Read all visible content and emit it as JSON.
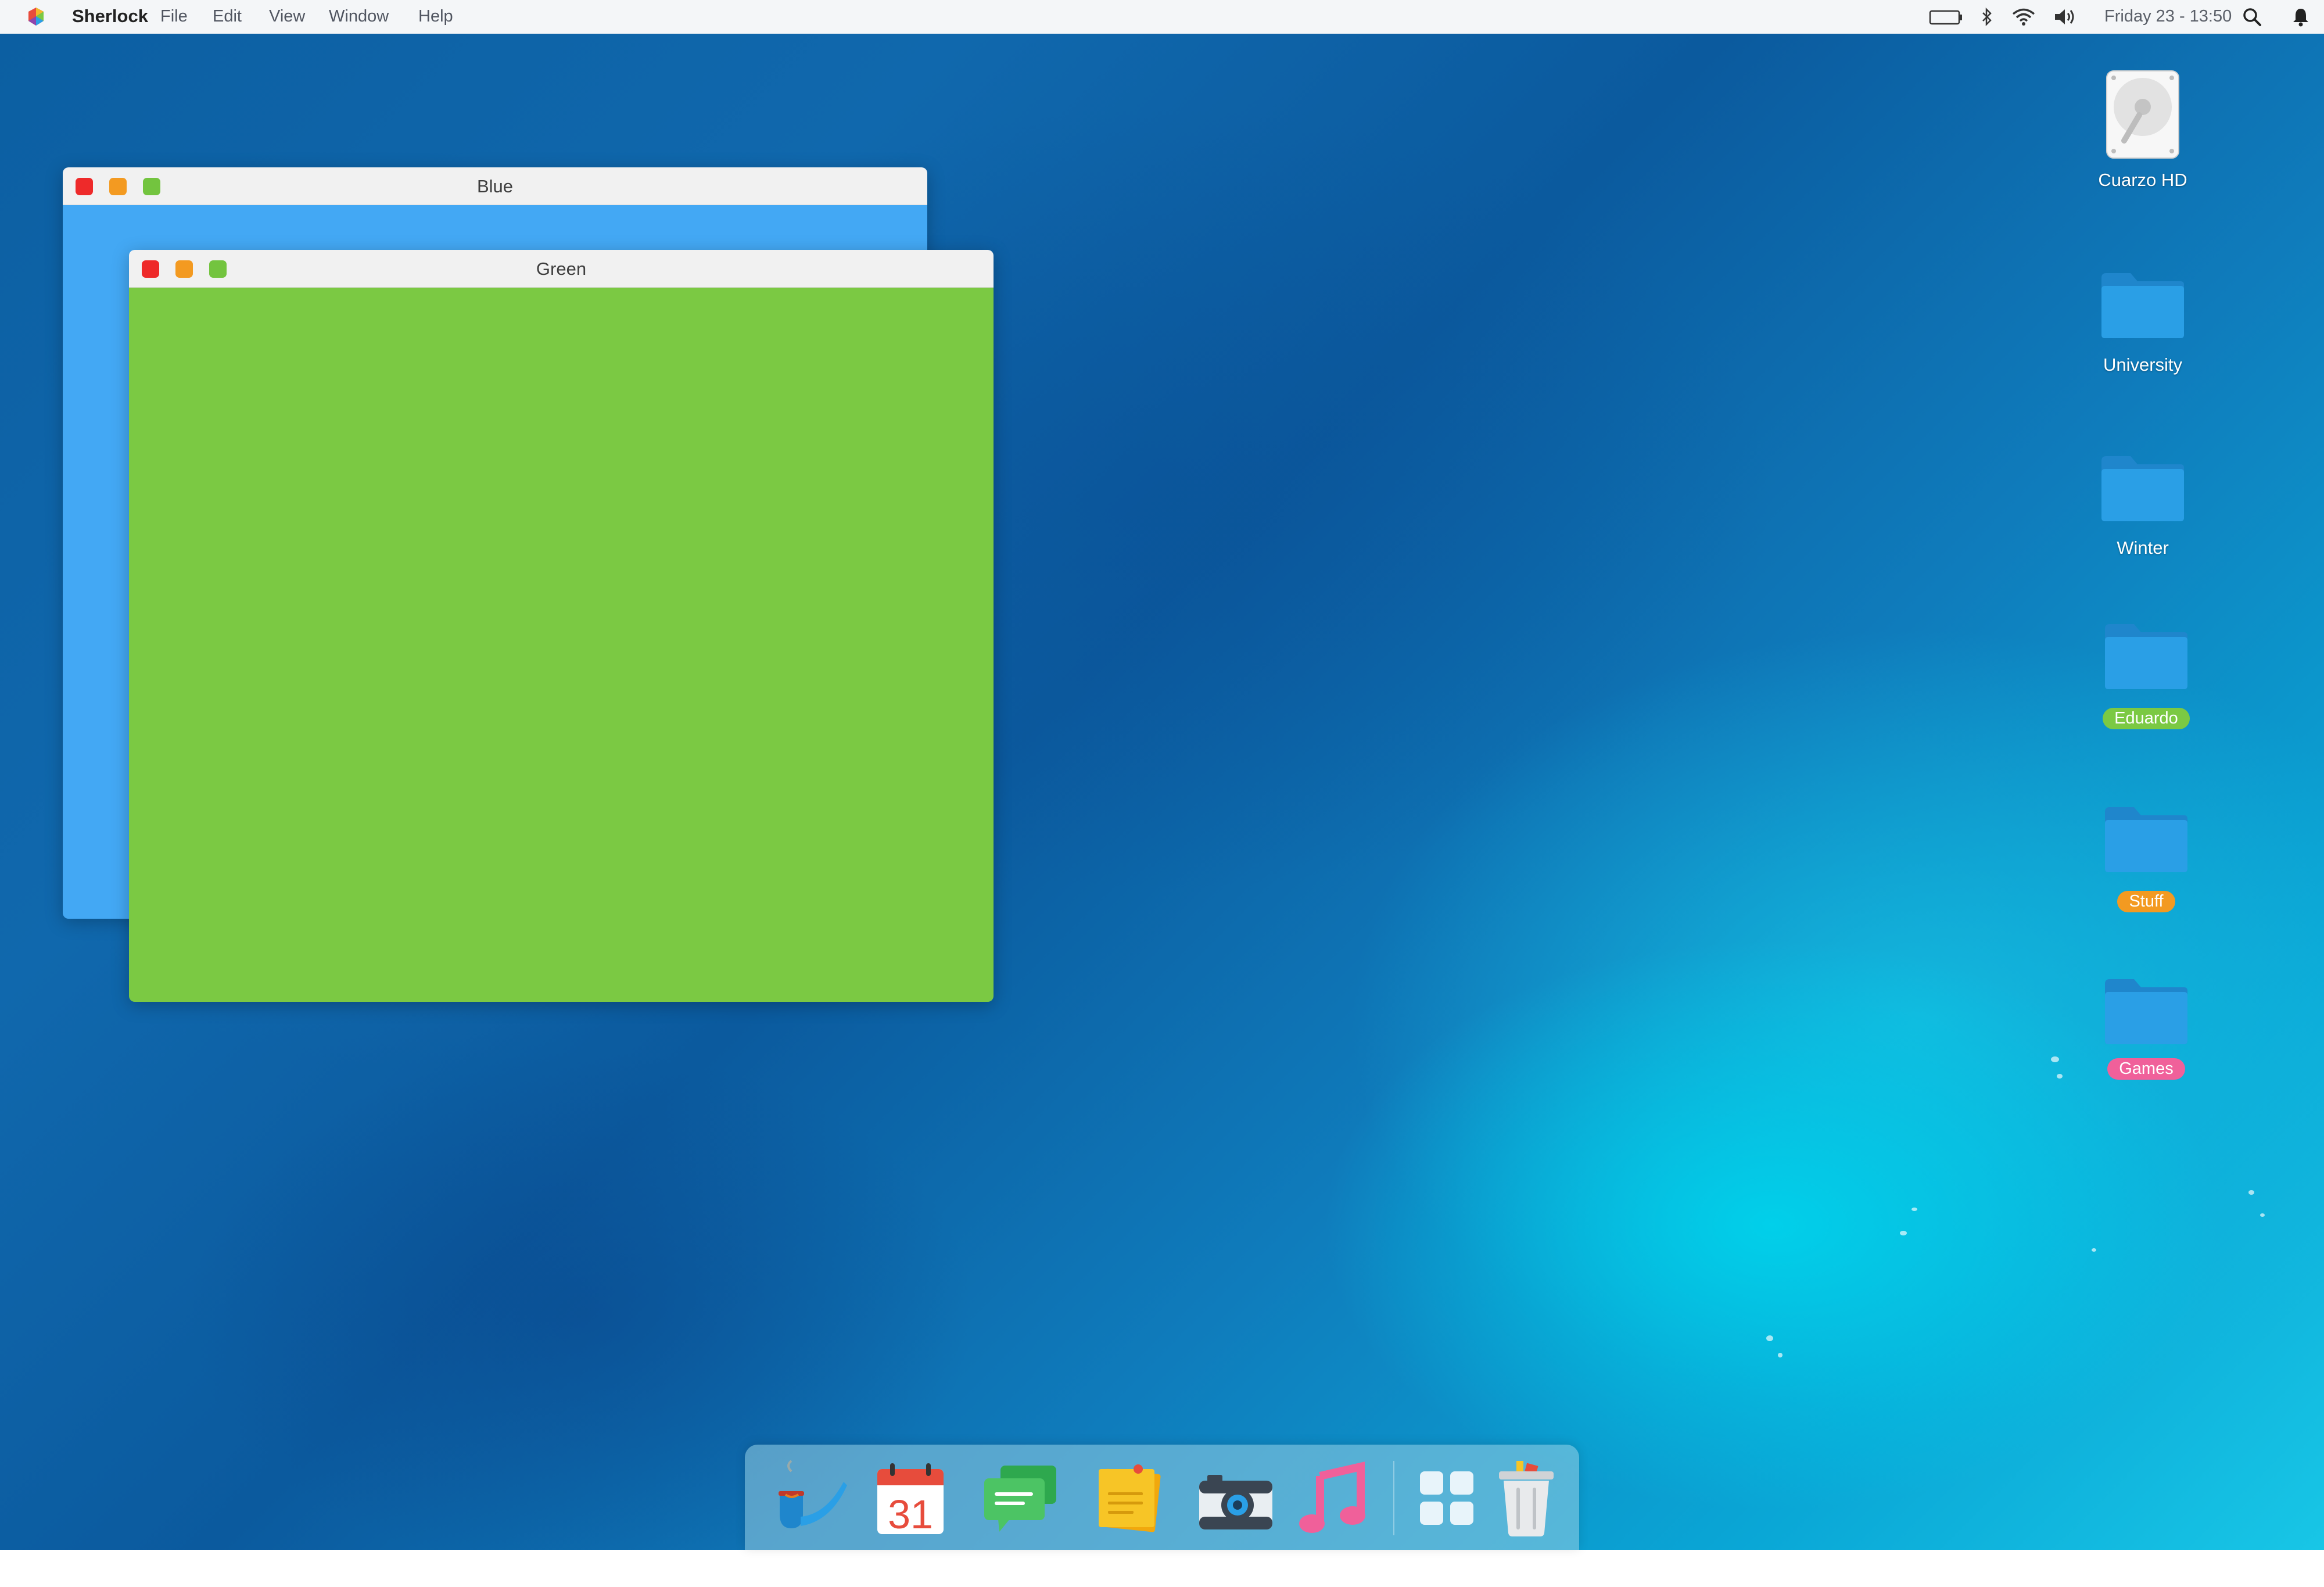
{
  "menubar": {
    "app_name": "Sherlock",
    "menus": [
      "File",
      "Edit",
      "View",
      "Window",
      "Help"
    ],
    "status_icons": [
      "battery-icon",
      "bluetooth-icon",
      "wifi-icon",
      "volume-icon"
    ],
    "clock": "Friday 23 - 13:50",
    "right_icons": [
      "search-icon",
      "notification-bell-icon"
    ]
  },
  "windows": [
    {
      "title": "Blue",
      "color": "#43a8f4",
      "traffic_lights": [
        "#ee2a2a",
        "#f39a21",
        "#73c43f"
      ]
    },
    {
      "title": "Green",
      "color": "#7bc943",
      "traffic_lights": [
        "#ee2a2a",
        "#f39a21",
        "#73c43f"
      ]
    }
  ],
  "desktop_icons": [
    {
      "label": "Cuarzo HD",
      "icon": "hard-drive-icon",
      "tag_color": null
    },
    {
      "label": "University",
      "icon": "folder-icon",
      "tag_color": null
    },
    {
      "label": "Winter",
      "icon": "folder-icon",
      "tag_color": null
    },
    {
      "label": "Eduardo",
      "icon": "folder-icon",
      "tag_color": "#7bc943"
    },
    {
      "label": "Stuff",
      "icon": "folder-icon",
      "tag_color": "#f39a21"
    },
    {
      "label": "Games",
      "icon": "folder-icon",
      "tag_color": "#f0609a"
    }
  ],
  "dock": {
    "apps": [
      "sherlock-pipe-icon",
      "calendar-icon",
      "messages-icon",
      "notes-icon",
      "camera-icon",
      "music-icon",
      "launcher-grid-icon",
      "trash-icon"
    ],
    "calendar_day": "31"
  },
  "colors": {
    "folder_blue": "#2a9fe6",
    "folder_tab": "#1f86cc"
  }
}
